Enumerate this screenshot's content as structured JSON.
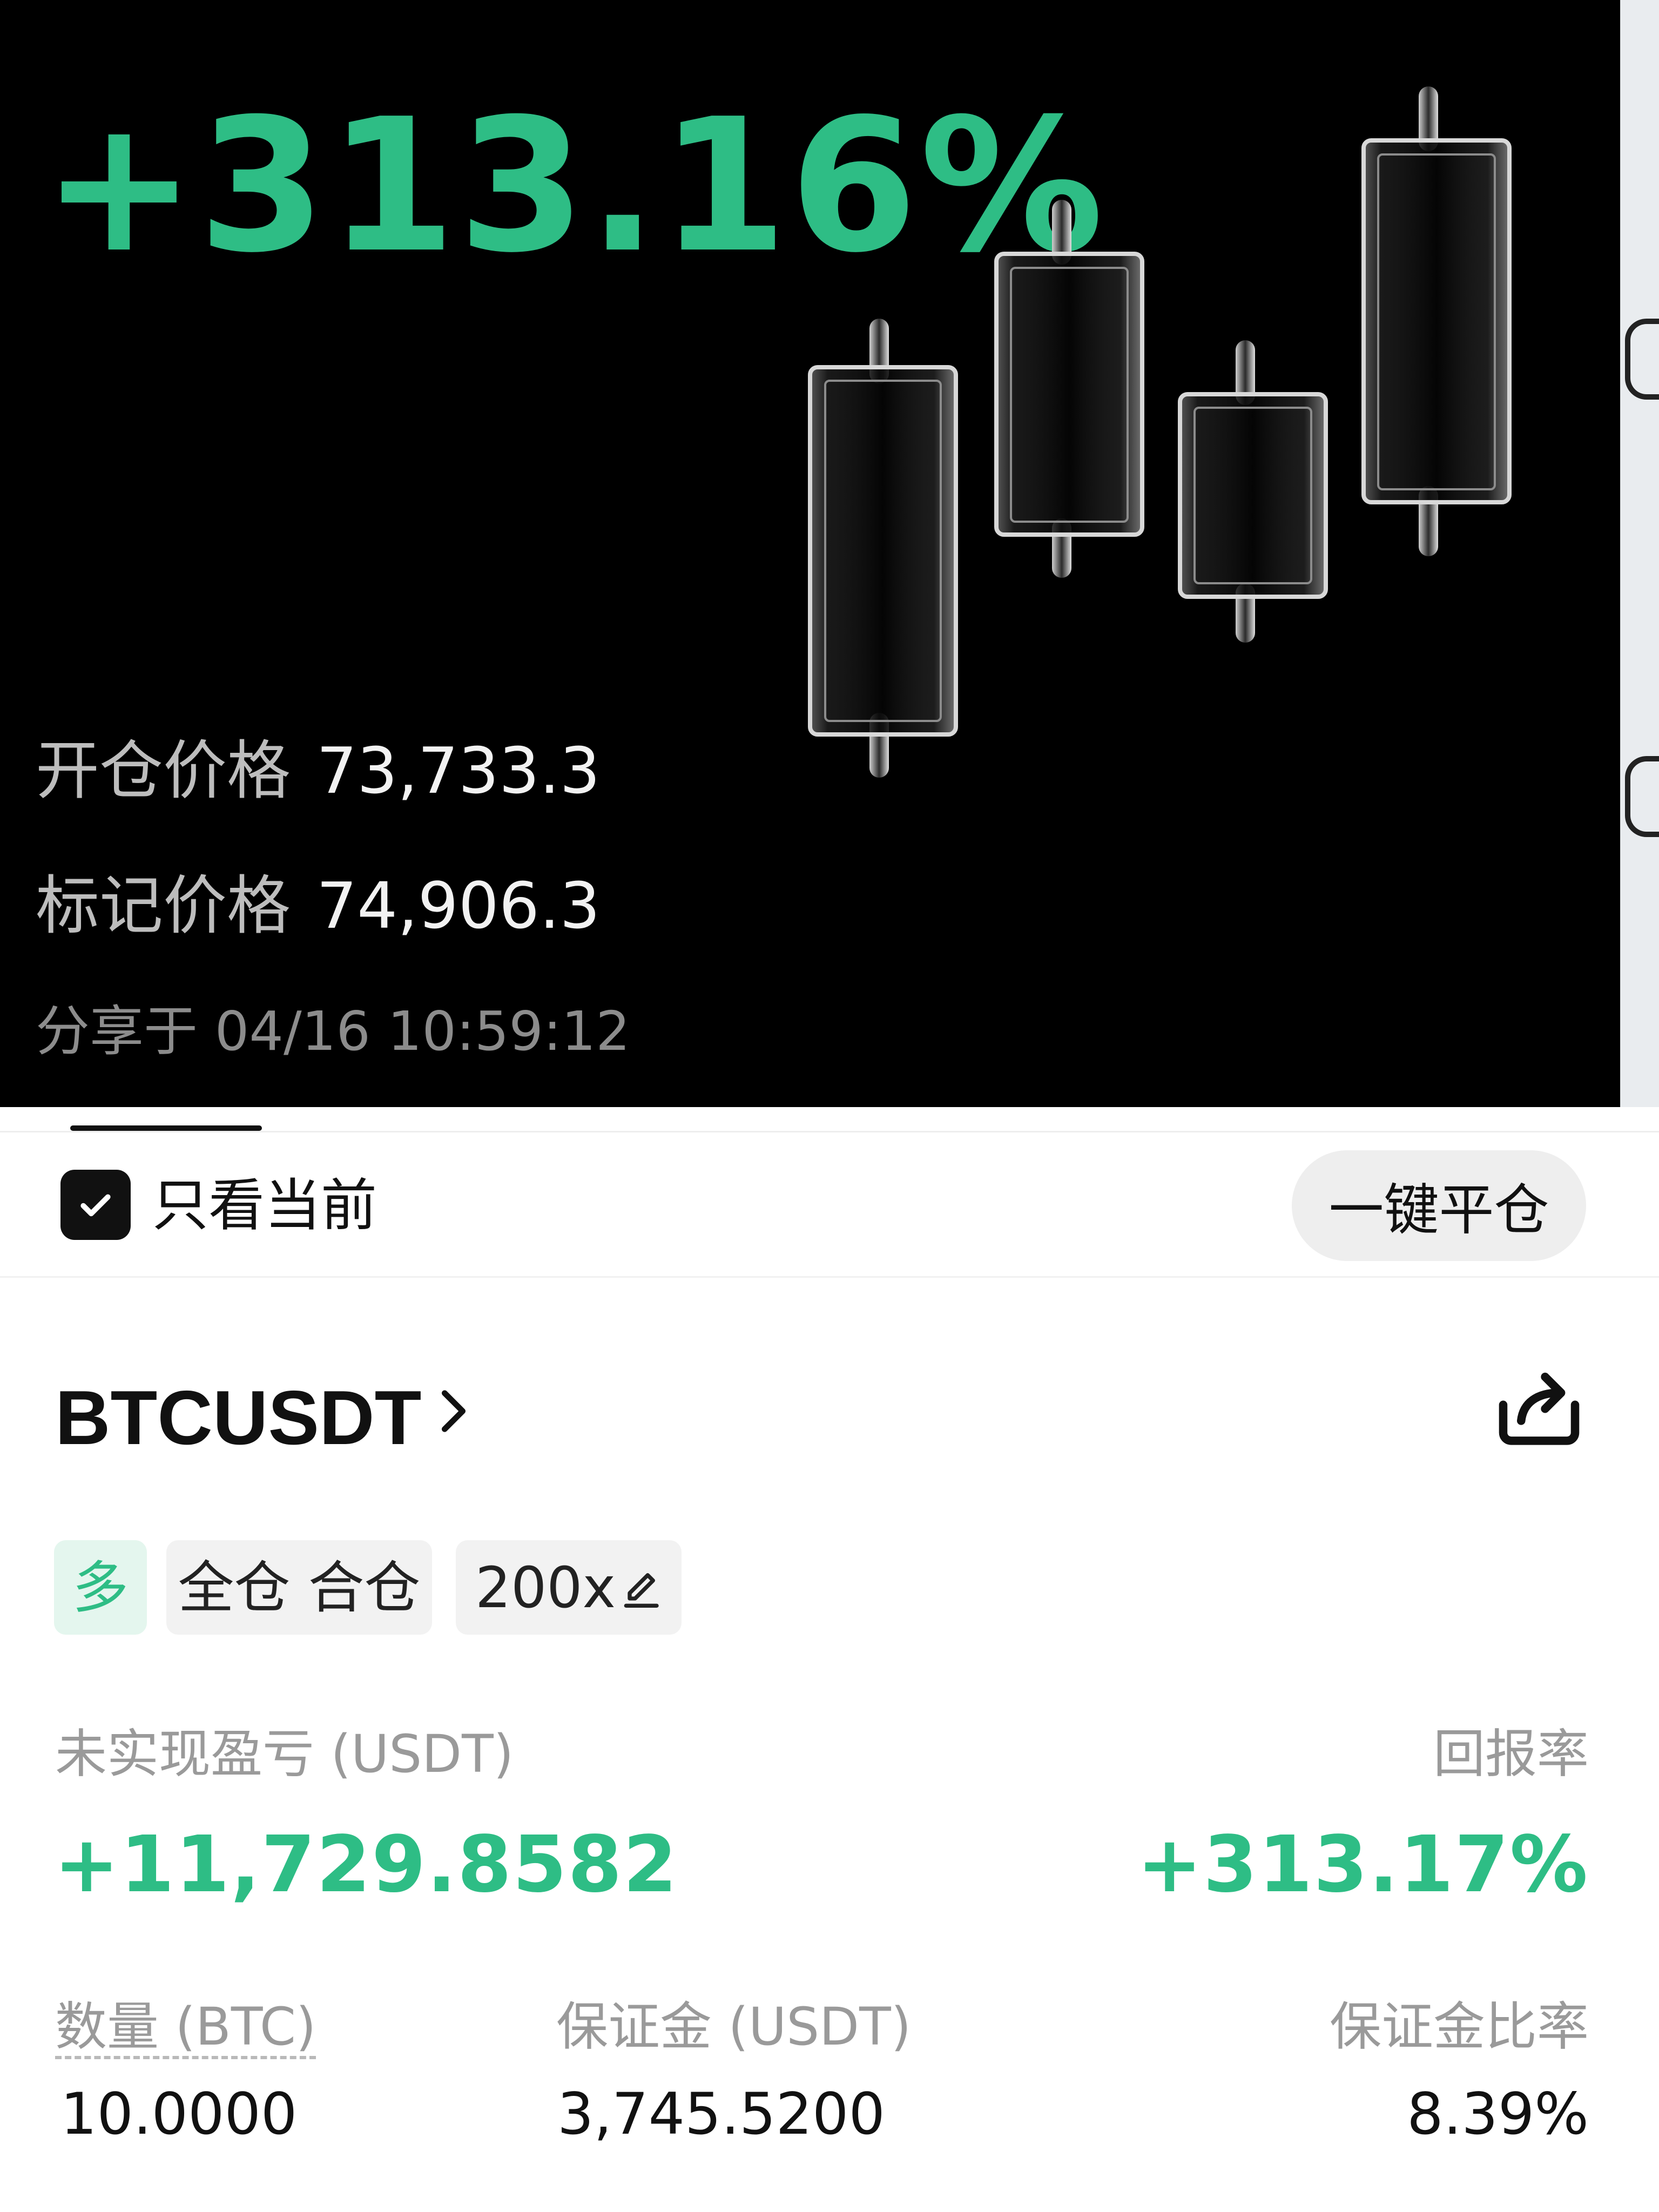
{
  "share_card": {
    "roi": "+313.16%",
    "entry_price": {
      "label": "开仓价格",
      "value": "73,733.3"
    },
    "mark_price": {
      "label": "标记价格",
      "value": "74,906.3"
    },
    "shared_at": "分享于 04/16 10:59:12"
  },
  "filter": {
    "only_current_label": "只看当前",
    "only_current_checked": true,
    "close_all_label": "一键平仓"
  },
  "position": {
    "symbol": "BTCUSDT",
    "tags": {
      "side": "多",
      "margin_mode": "全仓 合仓",
      "leverage": "200x"
    },
    "unrealized_pnl_label": "未实现盈亏 (USDT)",
    "unrealized_pnl": "+11,729.8582",
    "roe_label": "回报率",
    "roe": "+313.17%",
    "quantity_label": "数量 (BTC)",
    "quantity": "10.0000",
    "margin_label": "保证金 (USDT)",
    "margin": "3,745.5200",
    "margin_ratio_label": "保证金比率",
    "margin_ratio": "8.39%"
  },
  "colors": {
    "profit_green": "#2ebd85",
    "card_background": "#000000"
  },
  "icons": [
    "checkbox-checked-icon",
    "chevron-right-icon",
    "share-icon",
    "edit-pencil-icon",
    "candlestick-illustration"
  ]
}
